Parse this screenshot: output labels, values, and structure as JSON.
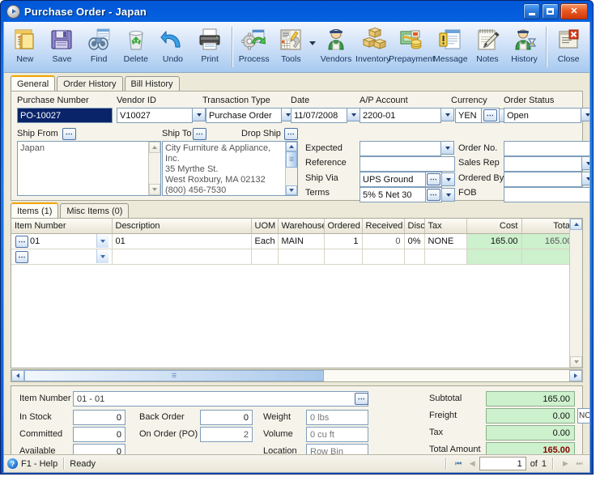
{
  "window": {
    "title": "Purchase Order - Japan",
    "icon": "app-play-icon",
    "buttons": {
      "minimize": "_",
      "maximize": "□",
      "close": "✕"
    }
  },
  "toolbar": {
    "items": [
      {
        "label": "New",
        "icon": "new-document-icon"
      },
      {
        "label": "Save",
        "icon": "floppy-disk-icon"
      },
      {
        "label": "Find",
        "icon": "binoculars-icon"
      },
      {
        "label": "Delete",
        "icon": "recycle-bin-icon"
      },
      {
        "label": "Undo",
        "icon": "undo-arrow-icon"
      },
      {
        "label": "Print",
        "icon": "printer-icon"
      },
      {
        "label": "Process",
        "icon": "gear-refresh-icon"
      },
      {
        "label": "Tools",
        "icon": "tools-icon"
      },
      {
        "label": "Vendors",
        "icon": "vendor-person-icon"
      },
      {
        "label": "Inventory",
        "icon": "boxes-icon"
      },
      {
        "label": "Prepayment",
        "icon": "money-icon"
      },
      {
        "label": "Message",
        "icon": "message-icon"
      },
      {
        "label": "Notes",
        "icon": "notepad-pencil-icon"
      },
      {
        "label": "History",
        "icon": "person-hourglass-icon"
      },
      {
        "label": "Close",
        "icon": "close-window-icon"
      }
    ]
  },
  "tabs": [
    {
      "label": "General",
      "active": true
    },
    {
      "label": "Order History",
      "active": false
    },
    {
      "label": "Bill History",
      "active": false
    }
  ],
  "general": {
    "purchase_number": {
      "label": "Purchase Number",
      "value": "PO-10027",
      "selected": true
    },
    "vendor_id": {
      "label": "Vendor ID",
      "value": "V10027"
    },
    "transaction_type": {
      "label": "Transaction Type",
      "value": "Purchase Order"
    },
    "date": {
      "label": "Date",
      "value": "11/07/2008"
    },
    "ap_account": {
      "label": "A/P Account",
      "value": "2200-01"
    },
    "currency": {
      "label": "Currency",
      "value": "YEN"
    },
    "order_status": {
      "label": "Order Status",
      "value": "Open"
    },
    "ship_from": {
      "label": "Ship From",
      "value": "Japan"
    },
    "ship_to": {
      "label": "Ship To",
      "value": "City Furniture & Appliance, Inc.\n35 Myrthe St.\nWest Roxbury, MA 02132\n(800) 456-7530"
    },
    "drop_ship": {
      "label": "Drop Ship"
    },
    "expected": {
      "label": "Expected",
      "value": ""
    },
    "reference": {
      "label": "Reference",
      "value": ""
    },
    "ship_via": {
      "label": "Ship Via",
      "value": "UPS Ground"
    },
    "terms": {
      "label": "Terms",
      "value": "5% 5 Net 30"
    },
    "order_no": {
      "label": "Order No.",
      "value": ""
    },
    "sales_rep": {
      "label": "Sales Rep",
      "value": ""
    },
    "ordered_by": {
      "label": "Ordered By",
      "value": ""
    },
    "fob": {
      "label": "FOB",
      "value": ""
    }
  },
  "item_tabs": [
    {
      "label": "Items (1)",
      "active": true
    },
    {
      "label": "Misc Items (0)",
      "active": false
    }
  ],
  "grid": {
    "columns": [
      "Item Number",
      "Description",
      "UOM",
      "Warehouse",
      "Ordered",
      "Received",
      "Disc",
      "Tax",
      "Cost",
      "Total"
    ],
    "rows": [
      {
        "item_number": "01",
        "description": "01",
        "uom": "Each",
        "warehouse": "MAIN",
        "ordered": "1",
        "received": "0",
        "disc": "0%",
        "tax": "NONE",
        "cost": "165.00",
        "total": "165.00"
      },
      {
        "item_number": "",
        "description": "",
        "uom": "",
        "warehouse": "",
        "ordered": "",
        "received": "",
        "disc": "",
        "tax": "",
        "cost": "",
        "total": ""
      }
    ],
    "footer_total": "1"
  },
  "detail": {
    "item_number": {
      "label": "Item Number",
      "value": "01 - 01"
    },
    "in_stock": {
      "label": "In Stock",
      "value": "0"
    },
    "committed": {
      "label": "Committed",
      "value": "0"
    },
    "available": {
      "label": "Available",
      "value": "0"
    },
    "back_order": {
      "label": "Back Order",
      "value": "0"
    },
    "on_order_po": {
      "label": "On Order (PO)",
      "value": "2"
    },
    "weight": {
      "label": "Weight",
      "value": "0 lbs"
    },
    "volume": {
      "label": "Volume",
      "value": "0 cu ft"
    },
    "location": {
      "label": "Location",
      "value": "Row  Bin"
    }
  },
  "totals": {
    "subtotal": {
      "label": "Subtotal",
      "value": "165.00"
    },
    "freight": {
      "label": "Freight",
      "value": "0.00",
      "code": "NC"
    },
    "tax": {
      "label": "Tax",
      "value": "0.00"
    },
    "total_amount": {
      "label": "Total Amount",
      "value": "165.00"
    }
  },
  "statusbar": {
    "help": "F1 - Help",
    "status": "Ready",
    "page_current": "1",
    "page_of": "of",
    "page_total": "1"
  },
  "colors": {
    "title_blue": "#0a6ae8",
    "panel_bg": "#f6f4ea",
    "green_field": "#cdf0cd",
    "total_red": "#8b0000",
    "tab_accent": "#f0a500"
  }
}
